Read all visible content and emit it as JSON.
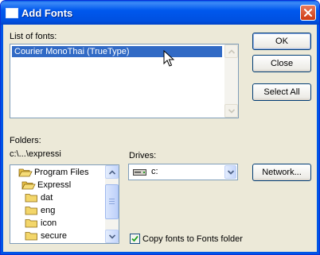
{
  "window": {
    "title": "Add Fonts",
    "close_label": "Close window"
  },
  "fonts": {
    "label": "List of fonts:",
    "items": [
      "Courier MonoThai (TrueType)"
    ],
    "selected_index": 0
  },
  "buttons": {
    "ok": "OK",
    "close": "Close",
    "select_all": "Select All",
    "network": "Network..."
  },
  "folders": {
    "label": "Folders:",
    "current_path": "c:\\...\\expressi",
    "tree": [
      {
        "label": "Program Files",
        "icon": "open-folder-icon"
      },
      {
        "label": "Expressl",
        "icon": "open-folder-icon"
      },
      {
        "label": "dat",
        "icon": "folder-icon"
      },
      {
        "label": "eng",
        "icon": "folder-icon"
      },
      {
        "label": "icon",
        "icon": "folder-icon"
      },
      {
        "label": "secure",
        "icon": "folder-icon"
      }
    ]
  },
  "drives": {
    "label": "Drives:",
    "selected": "c:",
    "icon": "drive-icon"
  },
  "copy_option": {
    "label": "Copy fonts to Fonts folder",
    "checked": true
  },
  "colors": {
    "titlebar": "#0058ee",
    "dialog_bg": "#ece9d8",
    "selection": "#316ac5",
    "close_button": "#e0512b"
  }
}
